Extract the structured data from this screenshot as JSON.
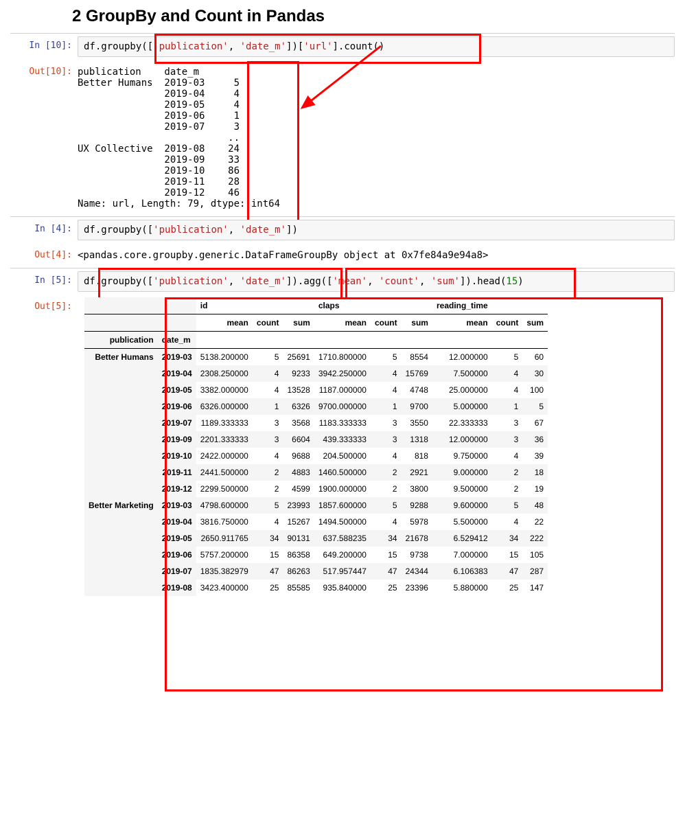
{
  "heading": "2  GroupBy and Count in Pandas",
  "cell10": {
    "in_prompt": "In [10]:",
    "out_prompt": "Out[10]:",
    "code_prefix": "df.groupby(",
    "code_bracket_open": "[",
    "code_str1": "'publication'",
    "code_comma": ", ",
    "code_str2": "'date_m'",
    "code_bracket_close": "])[",
    "code_str3": "'url'",
    "code_after": "].count()",
    "output_lines": [
      "publication    date_m ",
      "Better Humans  2019-03     5",
      "               2019-04     4",
      "               2019-05     4",
      "               2019-06     1",
      "               2019-07     3",
      "                          ..",
      "UX Collective  2019-08    24",
      "               2019-09    33",
      "               2019-10    86",
      "               2019-11    28",
      "               2019-12    46",
      "Name: url, Length: 79, dtype: int64"
    ]
  },
  "cell4": {
    "in_prompt": "In [4]:",
    "out_prompt": "Out[4]:",
    "code_prefix": "df.groupby(",
    "code_bracket_open": "[",
    "code_str1": "'publication'",
    "code_comma": ", ",
    "code_str2": "'date_m'",
    "code_end": "])",
    "output": "<pandas.core.groupby.generic.DataFrameGroupBy object at 0x7fe84a9e94a8>"
  },
  "cell5": {
    "in_prompt": "In [5]:",
    "out_prompt": "Out[5]:",
    "code_prefix": "df.",
    "code_groupby": "groupby(",
    "code_bracket_open": "[",
    "code_str1": "'publication'",
    "code_comma": ", ",
    "code_str2": "'date_m'",
    "code_close1": "]).",
    "code_agg": "agg(",
    "code_agg_open": "[",
    "code_agg1": "'mean'",
    "code_agg2": "'count'",
    "code_agg3": "'sum'",
    "code_close2": "]).",
    "code_head": "head(",
    "code_head_n": "15",
    "code_head_close": ")"
  },
  "table": {
    "top_headers": [
      "",
      "",
      "id",
      "",
      "",
      "claps",
      "",
      "",
      "reading_time",
      "",
      ""
    ],
    "sub_headers": [
      "",
      "",
      "mean",
      "count",
      "sum",
      "mean",
      "count",
      "sum",
      "mean",
      "count",
      "sum"
    ],
    "idx_headers": [
      "publication",
      "date_m"
    ],
    "rows": [
      {
        "pub": "Better Humans",
        "date": "2019-03",
        "v": [
          "5138.200000",
          "5",
          "25691",
          "1710.800000",
          "5",
          "8554",
          "12.000000",
          "5",
          "60"
        ]
      },
      {
        "pub": "",
        "date": "2019-04",
        "v": [
          "2308.250000",
          "4",
          "9233",
          "3942.250000",
          "4",
          "15769",
          "7.500000",
          "4",
          "30"
        ]
      },
      {
        "pub": "",
        "date": "2019-05",
        "v": [
          "3382.000000",
          "4",
          "13528",
          "1187.000000",
          "4",
          "4748",
          "25.000000",
          "4",
          "100"
        ]
      },
      {
        "pub": "",
        "date": "2019-06",
        "v": [
          "6326.000000",
          "1",
          "6326",
          "9700.000000",
          "1",
          "9700",
          "5.000000",
          "1",
          "5"
        ]
      },
      {
        "pub": "",
        "date": "2019-07",
        "v": [
          "1189.333333",
          "3",
          "3568",
          "1183.333333",
          "3",
          "3550",
          "22.333333",
          "3",
          "67"
        ]
      },
      {
        "pub": "",
        "date": "2019-09",
        "v": [
          "2201.333333",
          "3",
          "6604",
          "439.333333",
          "3",
          "1318",
          "12.000000",
          "3",
          "36"
        ]
      },
      {
        "pub": "",
        "date": "2019-10",
        "v": [
          "2422.000000",
          "4",
          "9688",
          "204.500000",
          "4",
          "818",
          "9.750000",
          "4",
          "39"
        ]
      },
      {
        "pub": "",
        "date": "2019-11",
        "v": [
          "2441.500000",
          "2",
          "4883",
          "1460.500000",
          "2",
          "2921",
          "9.000000",
          "2",
          "18"
        ]
      },
      {
        "pub": "",
        "date": "2019-12",
        "v": [
          "2299.500000",
          "2",
          "4599",
          "1900.000000",
          "2",
          "3800",
          "9.500000",
          "2",
          "19"
        ]
      },
      {
        "pub": "Better Marketing",
        "date": "2019-03",
        "v": [
          "4798.600000",
          "5",
          "23993",
          "1857.600000",
          "5",
          "9288",
          "9.600000",
          "5",
          "48"
        ]
      },
      {
        "pub": "",
        "date": "2019-04",
        "v": [
          "3816.750000",
          "4",
          "15267",
          "1494.500000",
          "4",
          "5978",
          "5.500000",
          "4",
          "22"
        ]
      },
      {
        "pub": "",
        "date": "2019-05",
        "v": [
          "2650.911765",
          "34",
          "90131",
          "637.588235",
          "34",
          "21678",
          "6.529412",
          "34",
          "222"
        ]
      },
      {
        "pub": "",
        "date": "2019-06",
        "v": [
          "5757.200000",
          "15",
          "86358",
          "649.200000",
          "15",
          "9738",
          "7.000000",
          "15",
          "105"
        ]
      },
      {
        "pub": "",
        "date": "2019-07",
        "v": [
          "1835.382979",
          "47",
          "86263",
          "517.957447",
          "47",
          "24344",
          "6.106383",
          "47",
          "287"
        ]
      },
      {
        "pub": "",
        "date": "2019-08",
        "v": [
          "3423.400000",
          "25",
          "85585",
          "935.840000",
          "25",
          "23396",
          "5.880000",
          "25",
          "147"
        ]
      }
    ]
  }
}
